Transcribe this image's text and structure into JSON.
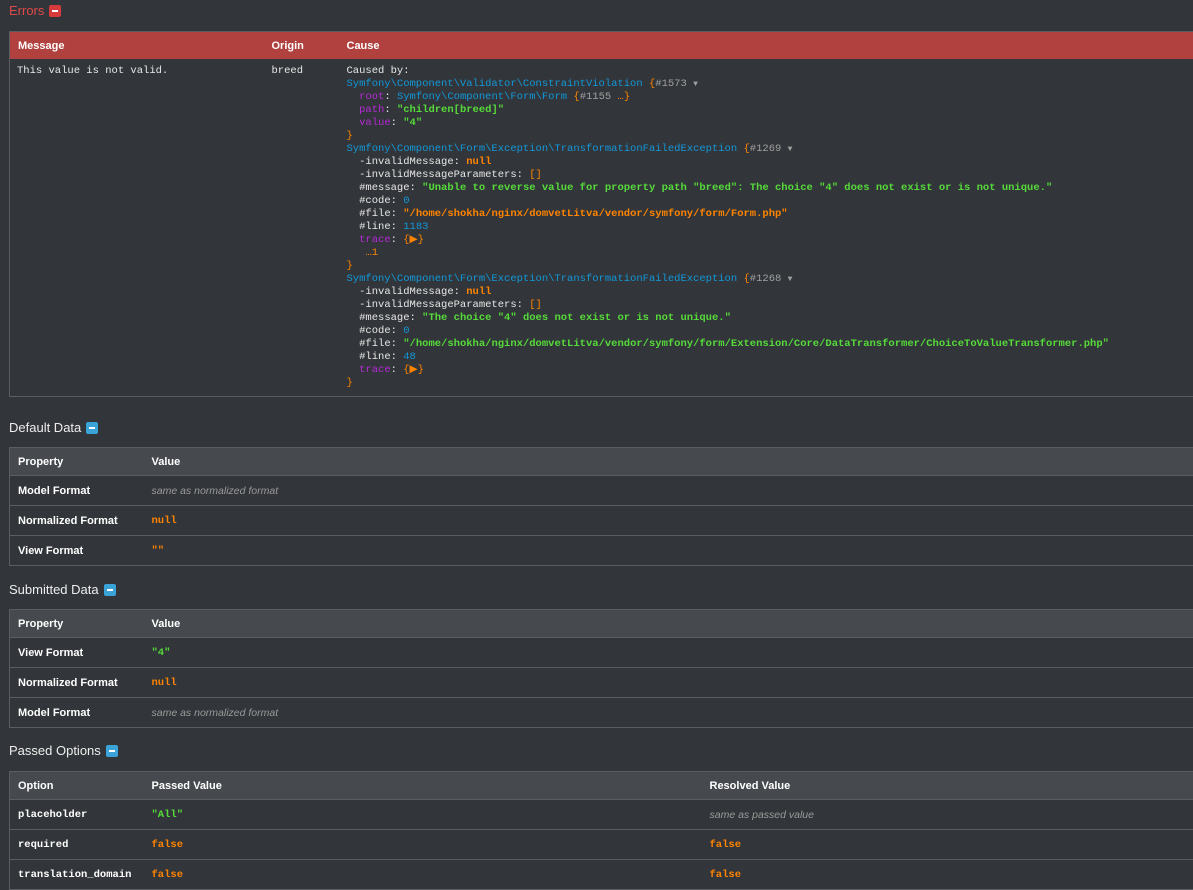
{
  "errors": {
    "title": "Errors",
    "headers": {
      "message": "Message",
      "origin": "Origin",
      "cause": "Cause"
    },
    "row": {
      "message": "This value is not valid.",
      "origin": "breed",
      "caused_by": "Caused by:",
      "violation": {
        "class": "Symfony\\Component\\Validator\\ConstraintViolation",
        "ref": "#1573",
        "root_key": "root",
        "root_class": "Symfony\\Component\\Form\\Form",
        "root_ref": "#1155",
        "root_more": "…}",
        "path_key": "path",
        "path_value": "\"children[breed]\"",
        "value_key": "value",
        "value_value": "\"4\""
      },
      "exception1": {
        "class": "Symfony\\Component\\Form\\Exception\\TransformationFailedException",
        "ref": "#1269",
        "invalid_message_key": "-invalidMessage",
        "invalid_message_value": "null",
        "invalid_params_key": "-invalidMessageParameters",
        "invalid_params_value": "[]",
        "message_key": "#message",
        "message_value": "\"Unable to reverse value for property path \"breed\": The choice \"4\" does not exist or is not unique.\"",
        "code_key": "#code",
        "code_value": "0",
        "file_key": "#file",
        "file_value": "\"/home/shokha/nginx/domvetLitva/vendor/symfony/form/Form.php\"",
        "line_key": "#line",
        "line_value": "1183",
        "trace_key": "trace",
        "trace_value": "{▶}",
        "trace_more": "…1"
      },
      "exception2": {
        "class": "Symfony\\Component\\Form\\Exception\\TransformationFailedException",
        "ref": "#1268",
        "invalid_message_key": "-invalidMessage",
        "invalid_message_value": "null",
        "invalid_params_key": "-invalidMessageParameters",
        "invalid_params_value": "[]",
        "message_key": "#message",
        "message_value": "\"The choice \"4\" does not exist or is not unique.\"",
        "code_key": "#code",
        "code_value": "0",
        "file_key": "#file",
        "file_value": "\"/home/shokha/nginx/domvetLitva/vendor/symfony/form/Extension/Core/DataTransformer/ChoiceToValueTransformer.php\"",
        "line_key": "#line",
        "line_value": "48",
        "trace_key": "trace",
        "trace_value": "{▶}"
      }
    }
  },
  "default_data": {
    "title": "Default Data",
    "headers": {
      "property": "Property",
      "value": "Value"
    },
    "rows": [
      {
        "property": "Model Format",
        "value": "same as normalized format"
      },
      {
        "property": "Normalized Format",
        "value": "null"
      },
      {
        "property": "View Format",
        "value": "\"\""
      }
    ]
  },
  "submitted_data": {
    "title": "Submitted Data",
    "headers": {
      "property": "Property",
      "value": "Value"
    },
    "rows": [
      {
        "property": "View Format",
        "value": "\"4\""
      },
      {
        "property": "Normalized Format",
        "value": "null"
      },
      {
        "property": "Model Format",
        "value": "same as normalized format"
      }
    ]
  },
  "passed_options": {
    "title": "Passed Options",
    "headers": {
      "option": "Option",
      "passed": "Passed Value",
      "resolved": "Resolved Value"
    },
    "rows": [
      {
        "option": "placeholder",
        "passed": "\"All\"",
        "resolved": "same as passed value"
      },
      {
        "option": "required",
        "passed": "false",
        "resolved": "false"
      },
      {
        "option": "translation_domain",
        "passed": "false",
        "resolved": "false"
      }
    ]
  },
  "colors": {
    "background": "#323539",
    "error_header": "#b0413e",
    "table_header": "#464a4f",
    "string": "#56db3a",
    "keyword": "#ff8400",
    "class": "#1299da",
    "property": "#b729d9"
  },
  "icons": {
    "errors_toggle": "collapse-minus-icon",
    "section_toggle": "collapse-minus-icon",
    "dump_toggle": "caret-down-icon"
  }
}
